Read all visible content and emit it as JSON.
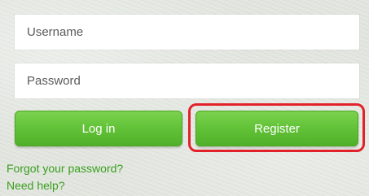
{
  "form": {
    "username": {
      "value": "",
      "placeholder": "Username"
    },
    "password": {
      "value": "",
      "placeholder": "Password"
    }
  },
  "buttons": {
    "login_label": "Log in",
    "register_label": "Register"
  },
  "links": {
    "forgot_password": "Forgot your password?",
    "need_help": "Need help?"
  },
  "colors": {
    "button_green": "#5fc035",
    "link_green": "#3a9e1e",
    "highlight_red": "#e2222a",
    "background": "#e4e8e1"
  }
}
